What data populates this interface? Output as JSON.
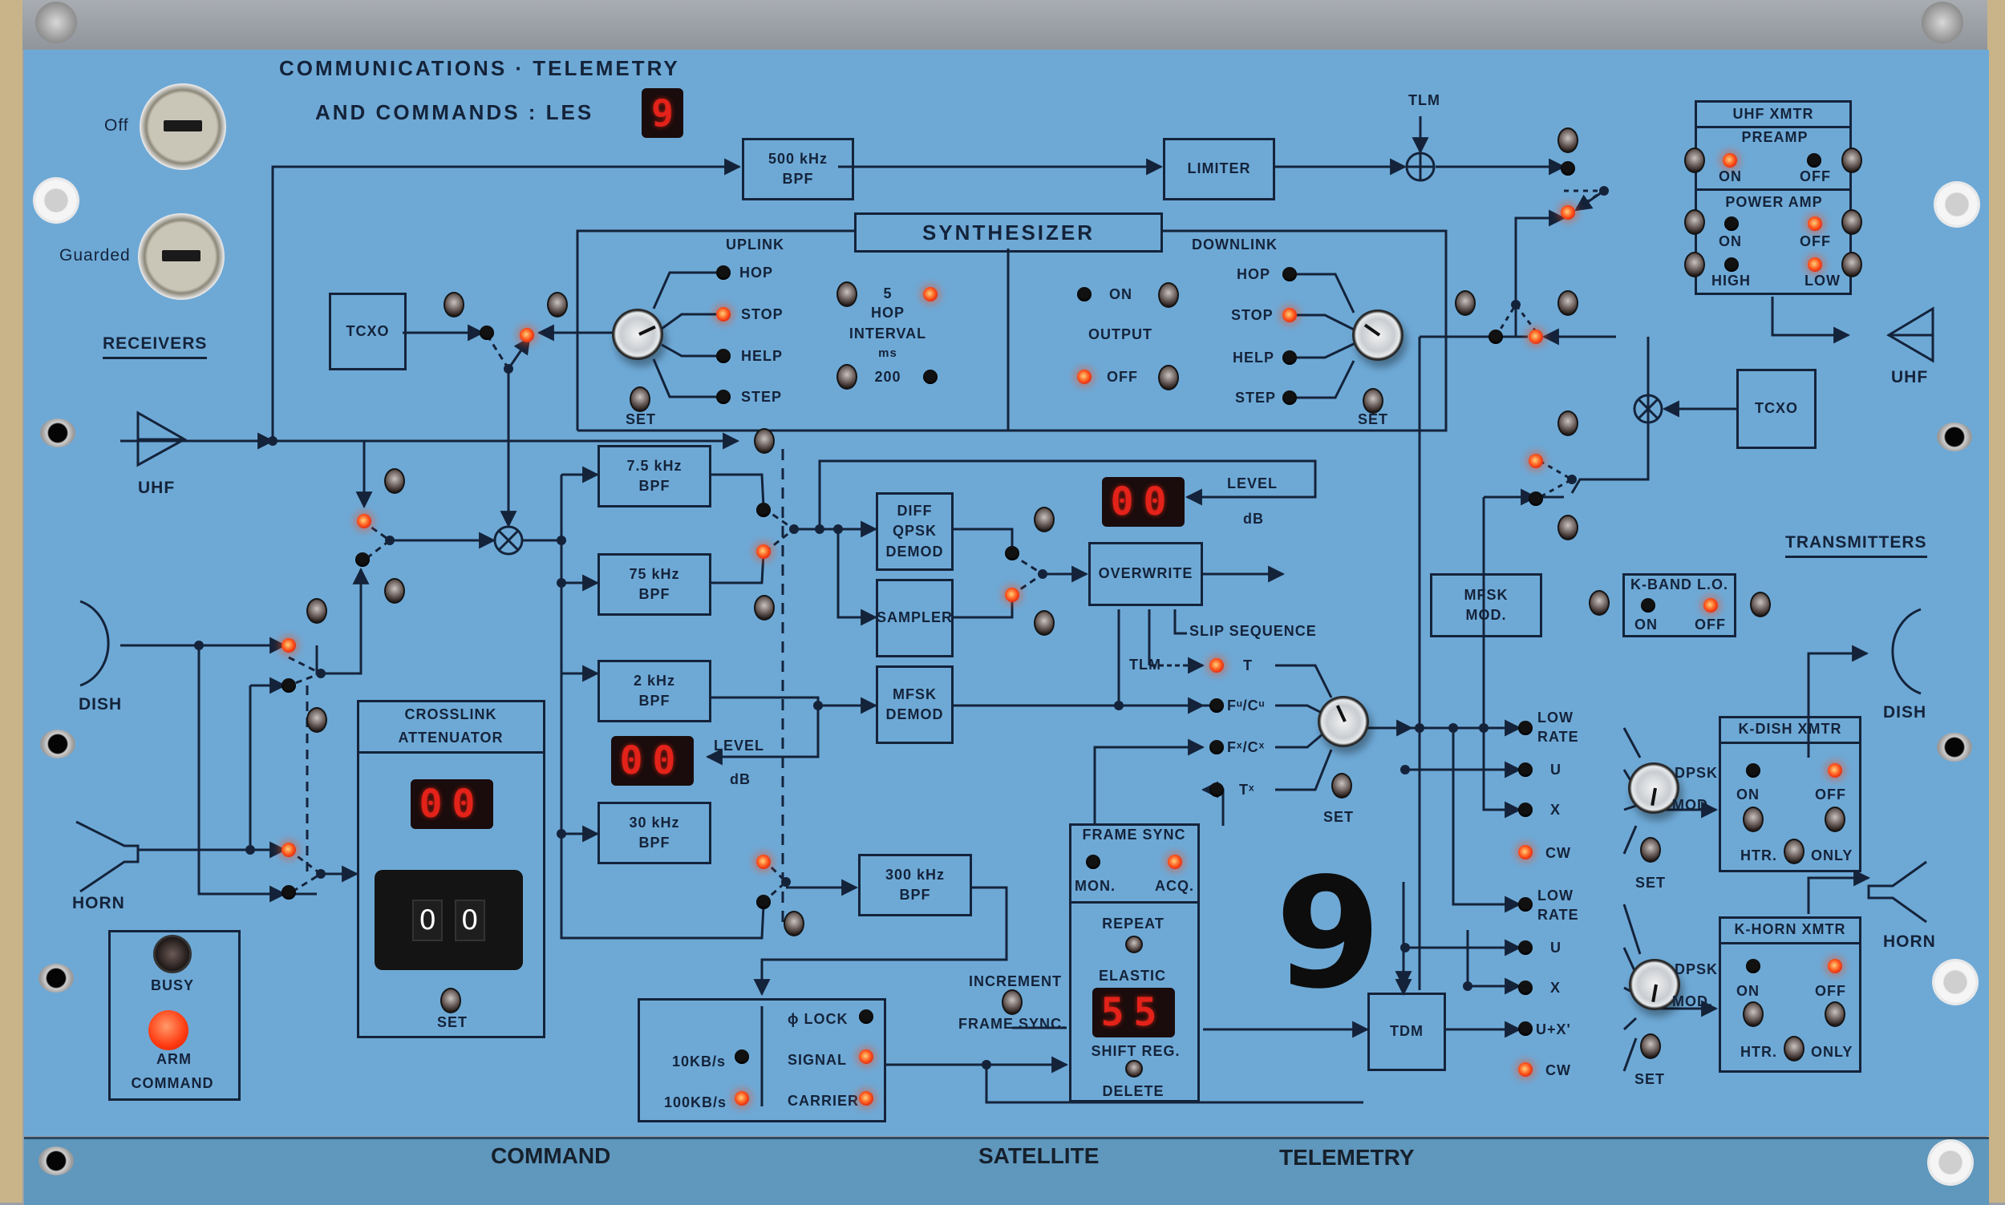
{
  "header": {
    "title_line1": "COMMUNICATIONS · TELEMETRY",
    "title_line2": "AND  COMMANDS : LES",
    "les_number": "9"
  },
  "key_switches": [
    {
      "label": "Off"
    },
    {
      "label": "Guarded"
    }
  ],
  "sections": {
    "receivers": "RECEIVERS",
    "transmitters": "TRANSMITTERS"
  },
  "antennas": {
    "rx_uhf": "UHF",
    "rx_dish": "DISH",
    "rx_horn": "HORN",
    "tx_uhf": "UHF",
    "tx_dish": "DISH",
    "tx_horn": "HORN"
  },
  "blocks": {
    "bpf_500": [
      "500 kHz",
      "BPF"
    ],
    "limiter": "LIMITER",
    "tlm_top": "TLM",
    "synthesizer": "SYNTHESIZER",
    "tcxo_left": "TCXO",
    "tcxo_right": "TCXO",
    "bpf_7_5": [
      "7.5 kHz",
      "BPF"
    ],
    "bpf_75": [
      "75 kHz",
      "BPF"
    ],
    "bpf_2": [
      "2 kHz",
      "BPF"
    ],
    "bpf_30": [
      "30 kHz",
      "BPF"
    ],
    "bpf_300": [
      "300 kHz",
      "BPF"
    ],
    "diff_qpsk": [
      "DIFF",
      "QPSK",
      "DEMOD"
    ],
    "sampler": "SAMPLER",
    "mfsk_demod": [
      "MFSK",
      "DEMOD"
    ],
    "overwrite": "OVERWRITE",
    "slip_sequence": "SLIP  SEQUENCE",
    "mfsk_mod": [
      "MFSK",
      "MOD."
    ],
    "tdm": "TDM"
  },
  "synthesizer": {
    "uplink": {
      "label": "UPLINK",
      "options": [
        {
          "label": "HOP",
          "lit": false
        },
        {
          "label": "STOP",
          "lit": true
        },
        {
          "label": "HELP",
          "lit": false
        },
        {
          "label": "STEP",
          "lit": false
        }
      ],
      "set_label": "SET"
    },
    "hop_interval": {
      "label": [
        "HOP",
        "INTERVAL",
        "ms"
      ],
      "options": [
        {
          "label": "5",
          "lit": true
        },
        {
          "label": "200",
          "lit": false
        }
      ]
    },
    "output": {
      "label": "OUTPUT",
      "options": [
        {
          "label": "ON",
          "lit": false
        },
        {
          "label": "OFF",
          "lit": true
        }
      ]
    },
    "downlink": {
      "label": "DOWNLINK",
      "options": [
        {
          "label": "HOP",
          "lit": false
        },
        {
          "label": "STOP",
          "lit": true
        },
        {
          "label": "HELP",
          "lit": false
        },
        {
          "label": "STEP",
          "lit": false
        }
      ],
      "set_label": "SET"
    }
  },
  "level_display_upper": {
    "value": "00",
    "label": "LEVEL",
    "unit": "dB"
  },
  "level_display_lower": {
    "value": "00",
    "label": "LEVEL",
    "unit": "dB"
  },
  "crosslink_attenuator": {
    "title": [
      "CROSSLINK",
      "ATTENUATOR"
    ],
    "display": "00",
    "thumbwheel": [
      "0",
      "0"
    ],
    "set_label": "SET"
  },
  "arm_command": {
    "busy_label": "BUSY",
    "arm_label": "ARM",
    "command_label": "COMMAND"
  },
  "telemetry_selector": {
    "tlm_label": "TLM",
    "options": [
      {
        "label": "T",
        "lit": true
      },
      {
        "label": "Fᵘ/Cᵘ",
        "lit": false
      },
      {
        "label": "Fˣ/Cˣ",
        "lit": false
      },
      {
        "label": "Tˣ",
        "lit": false
      }
    ],
    "set_label": "SET"
  },
  "frame_sync": {
    "title": "FRAME SYNC",
    "mon_label": "MON.",
    "acq_label": "ACQ.",
    "mon_lit": false,
    "acq_lit": true,
    "repeat_label": "REPEAT",
    "elastic_label": "ELASTIC",
    "display": "55",
    "shift_reg_label": "SHIFT  REG.",
    "delete_label": "DELETE",
    "increment_label": "INCREMENT",
    "frame_sync_label": "FRAME  SYNC."
  },
  "receiver_status": {
    "rates": [
      {
        "label": "10KB/s",
        "lit": false
      },
      {
        "label": "100KB/s",
        "lit": true
      }
    ],
    "status": [
      {
        "label": "ϕ LOCK",
        "lit": false
      },
      {
        "label": "SIGNAL",
        "lit": true
      },
      {
        "label": "CARRIER",
        "lit": true
      }
    ]
  },
  "satellite_number": "9",
  "uhf_xmtr": {
    "title": "UHF  XMTR",
    "preamp_label": "PREAMP",
    "power_amp_label": "POWER  AMP",
    "preamp": [
      {
        "label": "ON",
        "lit": true
      },
      {
        "label": "OFF",
        "lit": false
      }
    ],
    "power": [
      {
        "label": "ON",
        "lit": false
      },
      {
        "label": "OFF",
        "lit": true
      }
    ],
    "level": [
      {
        "label": "HIGH",
        "lit": false
      },
      {
        "label": "LOW",
        "lit": true
      }
    ]
  },
  "k_band_lo": {
    "title": "K-BAND  L.O.",
    "options": [
      {
        "label": "ON",
        "lit": false
      },
      {
        "label": "OFF",
        "lit": true
      }
    ]
  },
  "k_dish_mod": {
    "options": [
      {
        "label": [
          "LOW",
          "RATE"
        ],
        "lit": false
      },
      {
        "label": [
          "U"
        ],
        "lit": false
      },
      {
        "label": [
          "X"
        ],
        "lit": false
      },
      {
        "label": [
          "CW"
        ],
        "lit": true
      }
    ],
    "mod_label": [
      "DPSK",
      "MOD."
    ],
    "set_label": "SET"
  },
  "k_horn_mod": {
    "options": [
      {
        "label": [
          "LOW",
          "RATE"
        ],
        "lit": false
      },
      {
        "label": [
          "U"
        ],
        "lit": false
      },
      {
        "label": [
          "X"
        ],
        "lit": false
      },
      {
        "label": [
          "U+X'"
        ],
        "lit": false
      },
      {
        "label": [
          "CW"
        ],
        "lit": true
      }
    ],
    "mod_label": [
      "DPSK",
      "MOD."
    ],
    "set_label": "SET"
  },
  "k_dish_xmtr": {
    "title": "K-DISH  XMTR",
    "on_label": "ON",
    "off_label": "OFF",
    "on_lit": false,
    "off_lit": true,
    "htr_label": "HTR.",
    "only_label": "ONLY"
  },
  "k_horn_xmtr": {
    "title": "K-HORN  XMTR",
    "on_label": "ON",
    "off_label": "OFF",
    "on_lit": false,
    "off_lit": true,
    "htr_label": "HTR.",
    "only_label": "ONLY"
  },
  "bottom_strip": {
    "command": "COMMAND",
    "satellite": "SATELLITE",
    "telemetry": "TELEMETRY"
  },
  "colors": {
    "panel": "#6ea9d6",
    "ink": "#14233a",
    "led_on": "#ff4a1a",
    "led_off": "#111111",
    "segment": "#e3221a"
  }
}
